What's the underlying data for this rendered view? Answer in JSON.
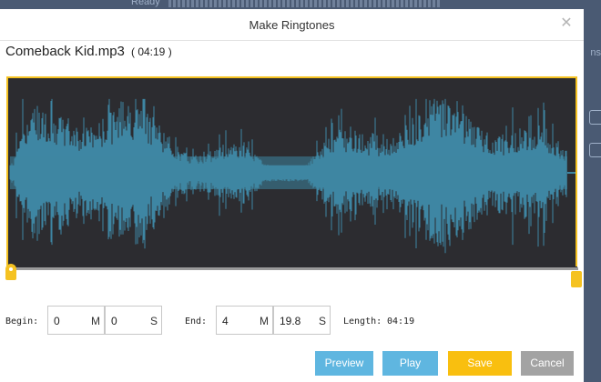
{
  "background": {
    "status_text": "Ready",
    "side_text": "ns"
  },
  "dialog": {
    "title": "Make Ringtones",
    "close_glyph": "✕",
    "file_name": "Comeback Kid.mp3",
    "file_duration": "( 04:19 )"
  },
  "controls": {
    "begin_label": "Begin:",
    "begin_minutes": "0",
    "begin_seconds": "0",
    "end_label": "End:",
    "end_minutes": "4",
    "end_seconds": "19.8",
    "minute_unit": "M",
    "second_unit": "S",
    "length_label": "Length:",
    "length_value": "04:19"
  },
  "buttons": {
    "preview": "Preview",
    "play": "Play",
    "save": "Save",
    "cancel": "Cancel"
  },
  "colors": {
    "accent_yellow": "#f5c221",
    "button_blue": "#5fb6e0",
    "button_gray": "#a3a3a3",
    "waveform": "#3e86a3",
    "waveform_bg": "#2c2c30"
  }
}
